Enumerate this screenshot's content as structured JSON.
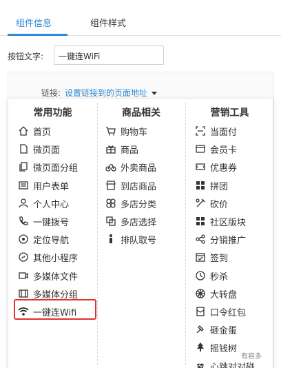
{
  "tabs": [
    {
      "label": "组件信息",
      "active": true
    },
    {
      "label": "组件样式",
      "active": false
    }
  ],
  "button_text_field": {
    "label": "按钮文字:",
    "value": "一键连WiFi"
  },
  "link": {
    "label": "链接:",
    "value": "设置链接到的页面地址"
  },
  "menu": {
    "columns": [
      {
        "title": "常用功能",
        "items": [
          {
            "label": "首页",
            "icon": "home-icon"
          },
          {
            "label": "微页面",
            "icon": "page-icon"
          },
          {
            "label": "微页面分组",
            "icon": "page-group-icon"
          },
          {
            "label": "用户表单",
            "icon": "form-icon"
          },
          {
            "label": "个人中心",
            "icon": "user-icon"
          },
          {
            "label": "一键拨号",
            "icon": "phone-icon"
          },
          {
            "label": "定位导航",
            "icon": "location-icon"
          },
          {
            "label": "其他小程序",
            "icon": "mini-program-icon"
          },
          {
            "label": "多媒体文件",
            "icon": "media-file-icon"
          },
          {
            "label": "多媒体分组",
            "icon": "media-group-icon"
          },
          {
            "label": "一键连Wifi",
            "icon": "wifi-icon",
            "highlighted": true
          }
        ]
      },
      {
        "title": "商品相关",
        "items": [
          {
            "label": "购物车",
            "icon": "cart-icon"
          },
          {
            "label": "商品",
            "icon": "gift-icon"
          },
          {
            "label": "外卖商品",
            "icon": "bike-icon"
          },
          {
            "label": "到店商品",
            "icon": "store-icon"
          },
          {
            "label": "多店分类",
            "icon": "clover-icon"
          },
          {
            "label": "多店选择",
            "icon": "multi-store-icon"
          },
          {
            "label": "排队取号",
            "icon": "queue-icon"
          }
        ]
      },
      {
        "title": "营销工具",
        "items": [
          {
            "label": "当面付",
            "icon": "scan-pay-icon"
          },
          {
            "label": "会员卡",
            "icon": "card-icon"
          },
          {
            "label": "优惠券",
            "icon": "coupon-icon"
          },
          {
            "label": "拼团",
            "icon": "group-buy-icon"
          },
          {
            "label": "砍价",
            "icon": "bargain-icon"
          },
          {
            "label": "社区版块",
            "icon": "community-icon"
          },
          {
            "label": "分销推广",
            "icon": "share-icon"
          },
          {
            "label": "签到",
            "icon": "calendar-check-icon"
          },
          {
            "label": "秒杀",
            "icon": "clock-icon"
          },
          {
            "label": "大转盘",
            "icon": "wheel-icon"
          },
          {
            "label": "口令红包",
            "icon": "red-packet-icon"
          },
          {
            "label": "砸金蛋",
            "icon": "hammer-icon"
          },
          {
            "label": "摇钱树",
            "icon": "tree-icon"
          },
          {
            "label": "心跳对对碰",
            "icon": "heartbeat-icon"
          }
        ]
      }
    ]
  },
  "watermark": "有容多",
  "colors": {
    "accent": "#2f89d3",
    "highlight": "#e03030",
    "text": "#333333"
  }
}
